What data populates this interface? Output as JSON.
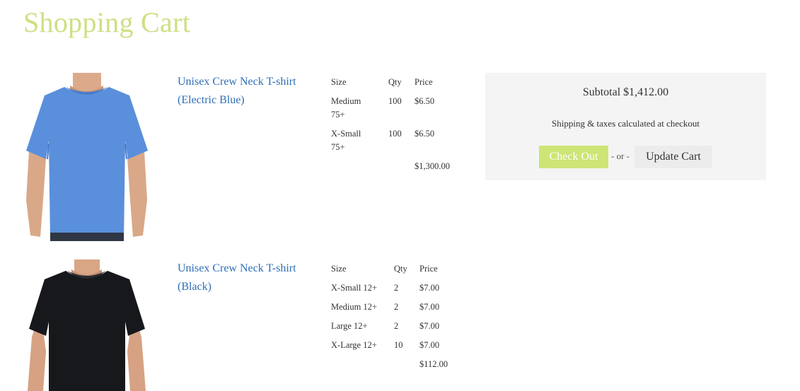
{
  "colors": {
    "title": "#cde083",
    "accent": "#cde575",
    "link": "#2e6fb7"
  },
  "page": {
    "title": "Shopping Cart"
  },
  "items": [
    {
      "name": "Unisex Crew Neck T-shirt (Electric Blue)",
      "image": "blue-crew-neck-tshirt",
      "headers": {
        "size": "Size",
        "qty": "Qty",
        "price": "Price"
      },
      "variants": [
        {
          "size": "Medium 75+",
          "qty": "100",
          "price": "$6.50"
        },
        {
          "size": "X-Small 75+",
          "qty": "100",
          "price": "$6.50"
        }
      ],
      "line_total": "$1,300.00"
    },
    {
      "name": "Unisex Crew Neck T-shirt (Black)",
      "image": "black-crew-neck-tshirt",
      "headers": {
        "size": "Size",
        "qty": "Qty",
        "price": "Price"
      },
      "variants": [
        {
          "size": "X-Small 12+",
          "qty": "2",
          "price": "$7.00"
        },
        {
          "size": "Medium 12+",
          "qty": "2",
          "price": "$7.00"
        },
        {
          "size": "Large 12+",
          "qty": "2",
          "price": "$7.00"
        },
        {
          "size": "X-Large 12+",
          "qty": "10",
          "price": "$7.00"
        }
      ],
      "line_total": "$112.00"
    }
  ],
  "summary": {
    "subtotal": "Subtotal $1,412.00",
    "shipping_note": "Shipping & taxes calculated at checkout",
    "checkout_label": "Check Out",
    "or_label": "- or -",
    "update_label": "Update Cart"
  }
}
